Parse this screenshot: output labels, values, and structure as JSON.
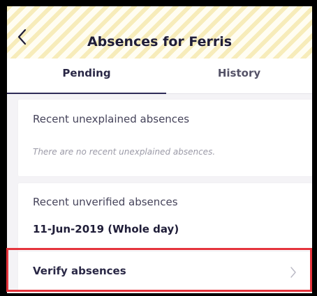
{
  "header": {
    "title": "Absences for Ferris",
    "back_icon": "chevron-left-icon"
  },
  "tabs": [
    {
      "label": "Pending",
      "selected": true
    },
    {
      "label": "History",
      "selected": false
    }
  ],
  "unexplained": {
    "heading": "Recent unexplained absences",
    "empty_message": "There are no recent unexplained absences."
  },
  "unverified": {
    "heading": "Recent unverified absences",
    "items": [
      "11-Jun-2019 (Whole day)"
    ],
    "action_label": "Verify absences",
    "action_icon": "chevron-right-icon"
  },
  "colors": {
    "primary": "#2f2c58",
    "highlight": "#e5343c",
    "header_stripe": "#f0de8c"
  }
}
